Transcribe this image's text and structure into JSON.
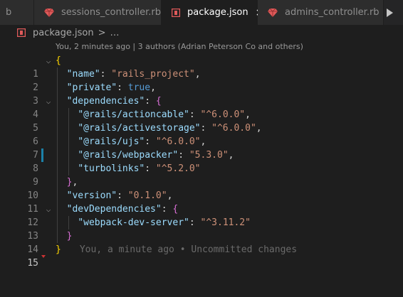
{
  "tabs": [
    {
      "label": "b",
      "type": "cut-tab"
    },
    {
      "label": "sessions_controller.rb",
      "icon": "ruby-icon"
    },
    {
      "label": "package.json",
      "icon": "json-icon",
      "active": true,
      "close": "×"
    },
    {
      "label": "admins_controller.rb",
      "icon": "ruby-icon"
    }
  ],
  "breadcrumb": {
    "file": "package.json",
    "separator": ">",
    "more": "…"
  },
  "codelens": "You, 2 minutes ago | 3 authors (Adrian Peterson Co and others)",
  "editor": {
    "lines": [
      {
        "n": "1"
      },
      {
        "n": "2"
      },
      {
        "n": "3"
      },
      {
        "n": "4"
      },
      {
        "n": "5"
      },
      {
        "n": "6"
      },
      {
        "n": "7"
      },
      {
        "n": "8"
      },
      {
        "n": "9"
      },
      {
        "n": "10"
      },
      {
        "n": "11"
      },
      {
        "n": "12"
      },
      {
        "n": "13"
      },
      {
        "n": "14"
      },
      {
        "n": "15"
      }
    ],
    "blame": "You, a minute ago • Uncommitted changes"
  },
  "json": {
    "name_key": "\"name\"",
    "name_val": "\"rails_project\"",
    "private_key": "\"private\"",
    "private_val": "true",
    "deps_key": "\"dependencies\"",
    "d1_key": "\"@rails/actioncable\"",
    "d1_val": "\"^6.0.0\"",
    "d2_key": "\"@rails/activestorage\"",
    "d2_val": "\"^6.0.0\"",
    "d3_key": "\"@rails/ujs\"",
    "d3_val": "\"^6.0.0\"",
    "d4_key": "\"@rails/webpacker\"",
    "d4_val": "\"5.3.0\"",
    "d5_key": "\"turbolinks\"",
    "d5_val": "\"^5.2.0\"",
    "version_key": "\"version\"",
    "version_val": "\"0.1.0\"",
    "devdeps_key": "\"devDependencies\"",
    "dd1_key": "\"webpack-dev-server\"",
    "dd1_val": "\"^3.11.2\""
  },
  "colors": {
    "ruby": "#e05a5a",
    "json_icon": "#e05a5a",
    "git_modified": "#1b81a8"
  }
}
